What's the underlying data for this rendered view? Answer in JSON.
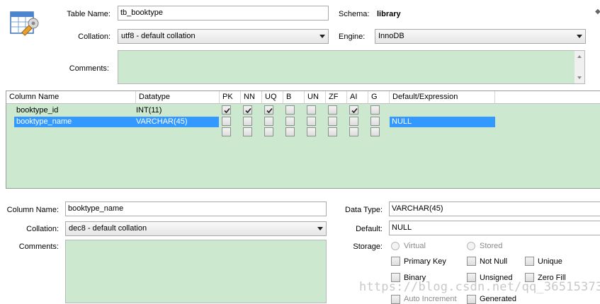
{
  "table": {
    "name_label": "Table Name:",
    "name_value": "tb_booktype",
    "schema_label": "Schema:",
    "schema_value": "library",
    "collation_label": "Collation:",
    "collation_value": "utf8 - default collation",
    "engine_label": "Engine:",
    "engine_value": "InnoDB",
    "comments_label": "Comments:",
    "comments_value": ""
  },
  "grid": {
    "headers": [
      "Column Name",
      "Datatype",
      "PK",
      "NN",
      "UQ",
      "B",
      "UN",
      "ZF",
      "AI",
      "G",
      "Default/Expression"
    ],
    "rows": [
      {
        "name": "booktype_id",
        "datatype": "INT(11)",
        "flags": [
          true,
          true,
          true,
          false,
          false,
          false,
          true,
          false
        ],
        "default": "",
        "selected": false
      },
      {
        "name": "booktype_name",
        "datatype": "VARCHAR(45)",
        "flags": [
          false,
          false,
          false,
          false,
          false,
          false,
          false,
          false
        ],
        "default": "NULL",
        "selected": true
      },
      {
        "name": "",
        "datatype": "",
        "flags": [
          false,
          false,
          false,
          false,
          false,
          false,
          false,
          false
        ],
        "default": "",
        "selected": false
      }
    ]
  },
  "detail": {
    "column_name_label": "Column Name:",
    "column_name_value": "booktype_name",
    "collation_label": "Collation:",
    "collation_value": "dec8 - default collation",
    "comments_label": "Comments:",
    "data_type_label": "Data Type:",
    "data_type_value": "VARCHAR(45)",
    "default_label": "Default:",
    "default_value": "NULL",
    "storage_label": "Storage:",
    "storage_virtual": "Virtual",
    "storage_stored": "Stored",
    "opt_primary_key": "Primary Key",
    "opt_not_null": "Not Null",
    "opt_unique": "Unique",
    "opt_binary": "Binary",
    "opt_unsigned": "Unsigned",
    "opt_zero_fill": "Zero Fill",
    "opt_auto_increment": "Auto Increment",
    "opt_generated": "Generated"
  },
  "watermark": "https://blog.csdn.net/qq_36515373",
  "colors": {
    "selection": "#3399ff",
    "panel_green": "#cce8cf"
  }
}
